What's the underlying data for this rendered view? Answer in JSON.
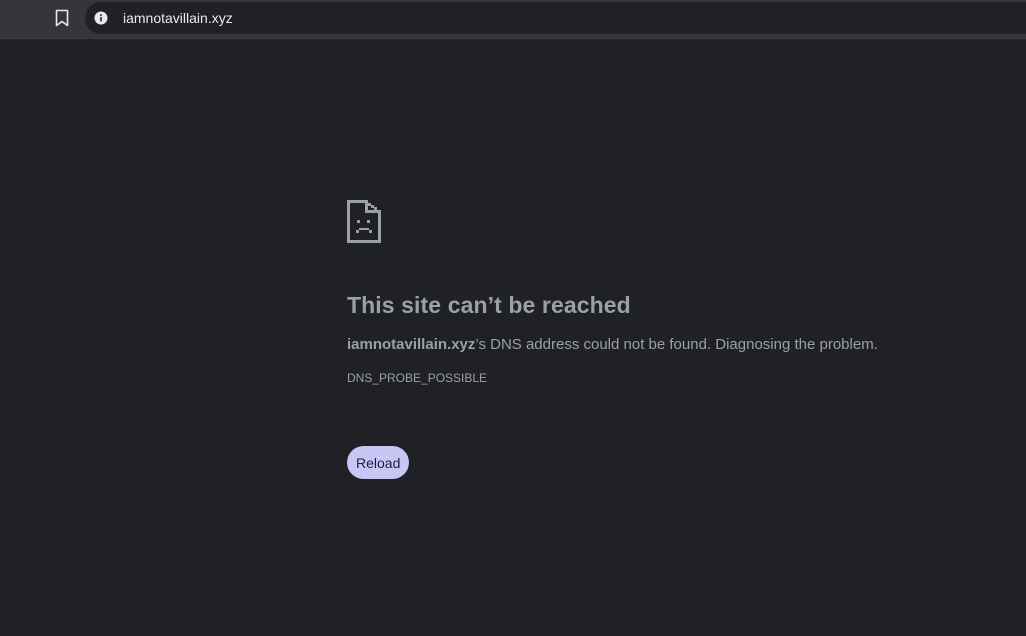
{
  "browser": {
    "url": "iamnotavillain.xyz",
    "bookmark_icon": "bookmark-icon",
    "site_info_icon": "info-icon"
  },
  "error_page": {
    "icon": "sad-page-icon",
    "title": "This site can’t be reached",
    "host": "iamnotavillain.xyz",
    "message_suffix": "’s DNS address could not be found. Diagnosing the problem.",
    "error_code": "DNS_PROBE_POSSIBLE",
    "reload_label": "Reload"
  },
  "colors": {
    "page_background": "#202124",
    "toolbar_background": "#35363a",
    "text_secondary": "#9aa0a6",
    "reload_button_background": "#c9c5f5"
  }
}
